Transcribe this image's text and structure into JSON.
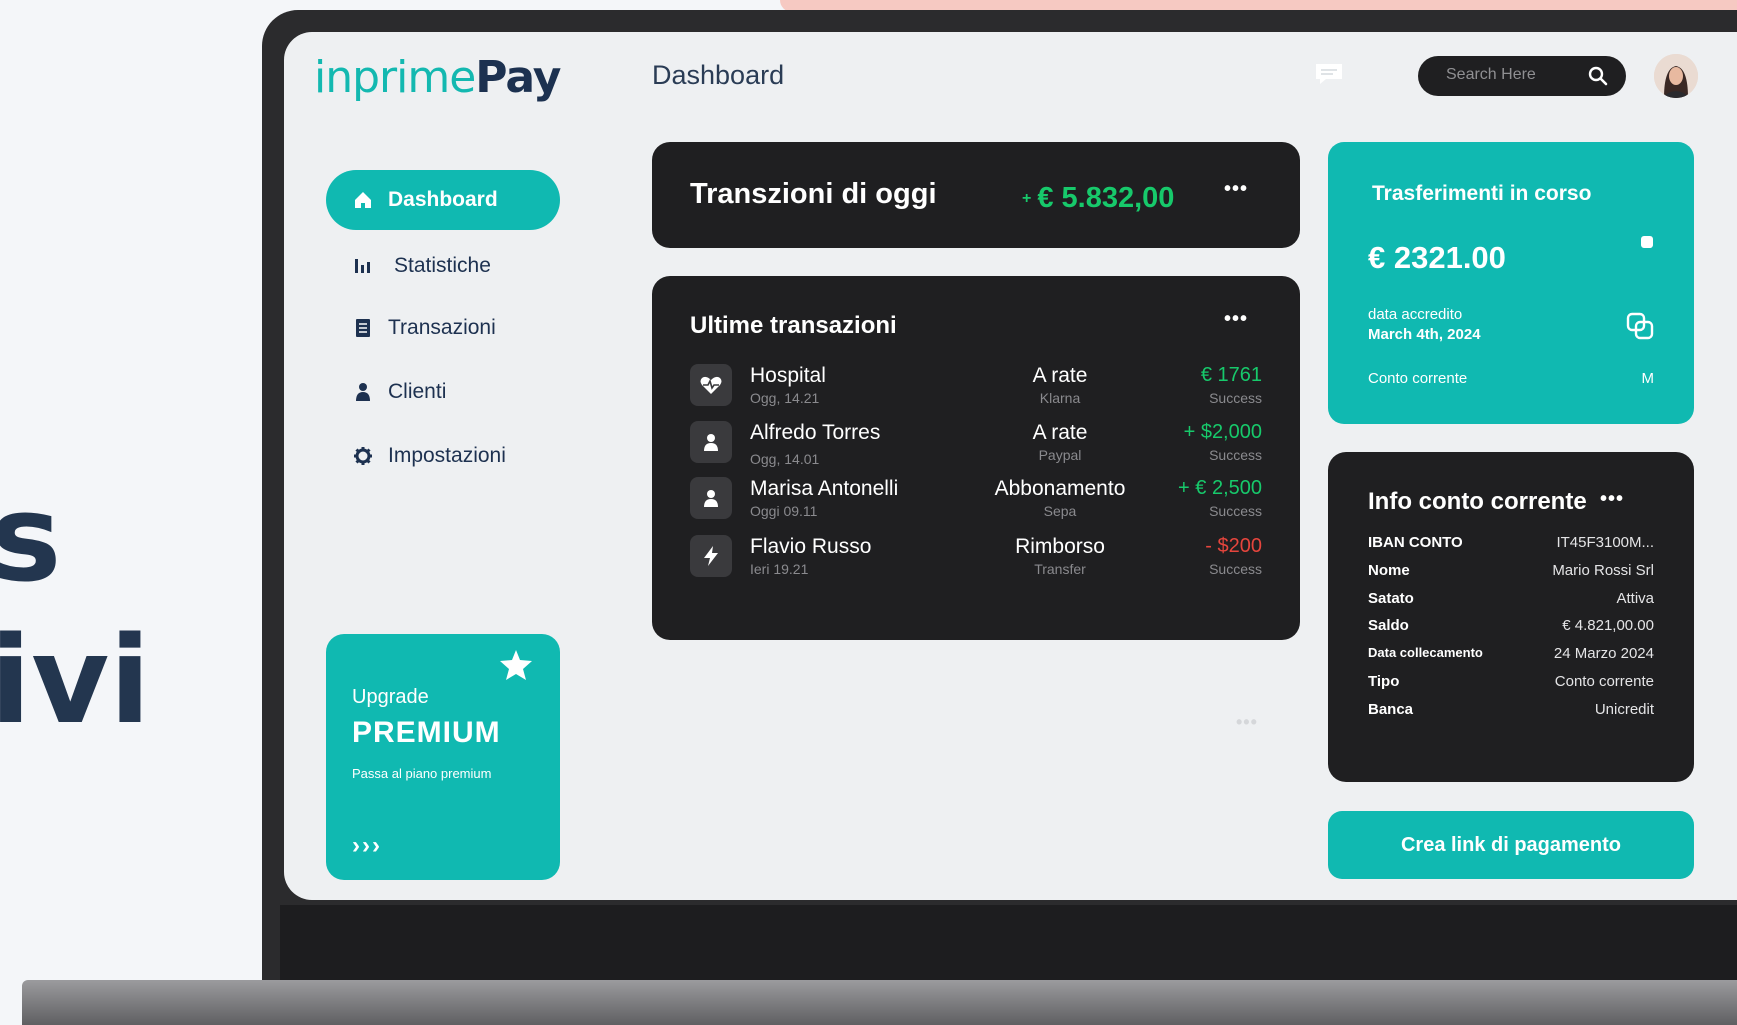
{
  "background_text": {
    "line1": "s",
    "line2": "ivi"
  },
  "colors": {
    "accent": "#10b9b1",
    "dark_card": "#1f1f21",
    "positive": "#17c96b",
    "negative": "#e6453d",
    "brand_dark": "#1c3150"
  },
  "logo": {
    "part1": "inprime",
    "part2": "Pay"
  },
  "header": {
    "title": "Dashboard",
    "search_placeholder": "Search Here",
    "icons": [
      "chat-icon",
      "search-icon",
      "avatar"
    ]
  },
  "sidebar": {
    "items": [
      {
        "label": "Dashboard",
        "icon": "home-icon",
        "active": true
      },
      {
        "label": "Statistiche",
        "icon": "bar-chart-icon",
        "active": false
      },
      {
        "label": "Transazioni",
        "icon": "document-icon",
        "active": false
      },
      {
        "label": "Clienti",
        "icon": "user-icon",
        "active": false
      },
      {
        "label": "Impostazioni",
        "icon": "gear-icon",
        "active": false
      }
    ],
    "upgrade": {
      "label": "Upgrade",
      "title": "PREMIUM",
      "subtitle": "Passa al piano premium",
      "arrows": "›››"
    }
  },
  "today": {
    "title": "Transzioni di oggi",
    "plus": "+",
    "amount": "€ 5.832,00"
  },
  "last_transactions": {
    "title": "Ultime transazioni",
    "rows": [
      {
        "name": "Hospital",
        "time": "Ogg, 14.21",
        "category": "A rate",
        "method": "Klarna",
        "amount": "€ 1761",
        "status": "Success",
        "sign": "positive",
        "icon": "heartbeat-icon"
      },
      {
        "name": "Alfredo Torres",
        "time": "Ogg, 14.01",
        "category": "A rate",
        "method": "Paypal",
        "amount": "+ $2,000",
        "status": "Success",
        "sign": "positive",
        "icon": "user-icon"
      },
      {
        "name": "Marisa Antonelli",
        "time": "Oggi 09.11",
        "category": "Abbonamento",
        "method": "Sepa",
        "amount": "+ € 2,500",
        "status": "Success",
        "sign": "positive",
        "icon": "user-icon"
      },
      {
        "name": "Flavio Russo",
        "time": "Ieri 19.21",
        "category": "Rimborso",
        "method": "Transfer",
        "amount": "- $200",
        "status": "Success",
        "sign": "negative",
        "icon": "bolt-icon"
      }
    ]
  },
  "transfer": {
    "title": "Trasferimenti in corso",
    "amount": "€ 2321.00",
    "date_label": "data accredito",
    "date": "March 4th, 2024",
    "account_label": "Conto corrente",
    "account_suffix": "M"
  },
  "account_info": {
    "title": "Info conto corrente",
    "rows": [
      {
        "key": "IBAN CONTO",
        "value": "IT45F3100M..."
      },
      {
        "key": "Nome",
        "value": "Mario Rossi Srl"
      },
      {
        "key": "Satato",
        "value": "Attiva"
      },
      {
        "key": "Saldo",
        "value": "€ 4.821,00.00"
      },
      {
        "key": "Data collecamento",
        "value": "24 Marzo 2024"
      },
      {
        "key": "Tipo",
        "value": "Conto corrente"
      },
      {
        "key": "Banca",
        "value": "Unicredit"
      }
    ]
  },
  "payment_button": {
    "label": "Crea link di pagamento"
  },
  "more_menu": "•••"
}
